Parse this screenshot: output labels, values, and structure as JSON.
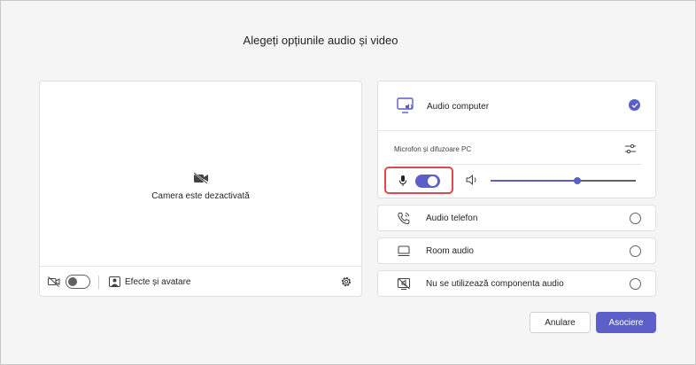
{
  "dialog": {
    "title": "Alegeți opțiunile audio și video"
  },
  "preview": {
    "camera_status": "Camera este dezactivată",
    "camera_toggle_on": false,
    "effects_label": "Efecte și avatare"
  },
  "audio": {
    "computer": {
      "label": "Audio computer",
      "selected": true,
      "device_label": "Microfon și difuzoare PC",
      "mic_on": true,
      "volume_level": 0.6
    },
    "options": [
      {
        "label": "Audio telefon",
        "icon": "phone-icon",
        "selected": false
      },
      {
        "label": "Room audio",
        "icon": "room-audio-icon",
        "selected": false
      },
      {
        "label": "Nu se utilizează componenta audio",
        "icon": "no-audio-icon",
        "selected": false
      }
    ]
  },
  "actions": {
    "cancel_label": "Anulare",
    "join_label": "Asociere"
  },
  "colors": {
    "accent": "#5b5fc7",
    "highlight_border": "#e04a4a"
  }
}
